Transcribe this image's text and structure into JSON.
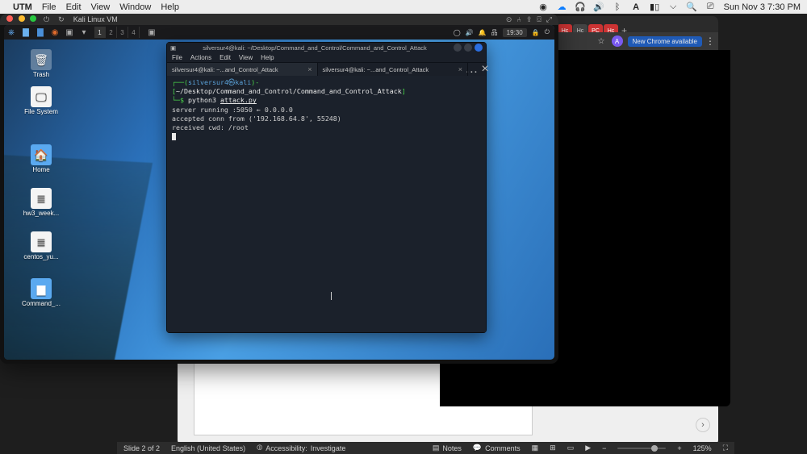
{
  "mac": {
    "app": "UTM",
    "menus": [
      "File",
      "Edit",
      "View",
      "Window",
      "Help"
    ],
    "clock": "Sun Nov 3  7:30 PM"
  },
  "utm": {
    "title": "Kali Linux VM"
  },
  "chrome": {
    "tabs": [
      "Hc",
      "Hc",
      "PC",
      "Hc"
    ],
    "pill": "New Chrome available"
  },
  "kali": {
    "workspaces": [
      "1",
      "2",
      "3",
      "4"
    ],
    "clock": "19:30",
    "icons": {
      "trash": "Trash",
      "filesystem": "File System",
      "home": "Home",
      "hw3": "hw3_week...",
      "centos": "centos_yu...",
      "command": "Command_..."
    }
  },
  "terminal": {
    "title": "silversur4@kali: ~/Desktop/Command_and_Control/Command_and_Control_Attack",
    "menus": [
      "File",
      "Actions",
      "Edit",
      "View",
      "Help"
    ],
    "tabs": [
      "silversur4@kali: ~...and_Control_Attack",
      "silversur4@kali: ~...and_Control_Attack"
    ],
    "prompt": {
      "open": "┌──(",
      "user": "silversur4㉿kali",
      "sep": ")-[",
      "cwd": "~/Desktop/Command_and_Control/Command_and_Control_Attack",
      "close": "]",
      "line2": "└─$ ",
      "cmd_pre": "python3 ",
      "cmd_file": "attack.py"
    },
    "output": [
      "server running :5050 ← 0.0.0.0",
      "accepted conn from ('192.168.64.8', 55248)",
      "received cwd: /root"
    ]
  },
  "status": {
    "slide": "Slide 2 of 2",
    "lang": "English (United States)",
    "a11y_label": "Accessibility:",
    "a11y_val": "Investigate",
    "notes": "Notes",
    "comments": "Comments",
    "zoom": "125%"
  }
}
